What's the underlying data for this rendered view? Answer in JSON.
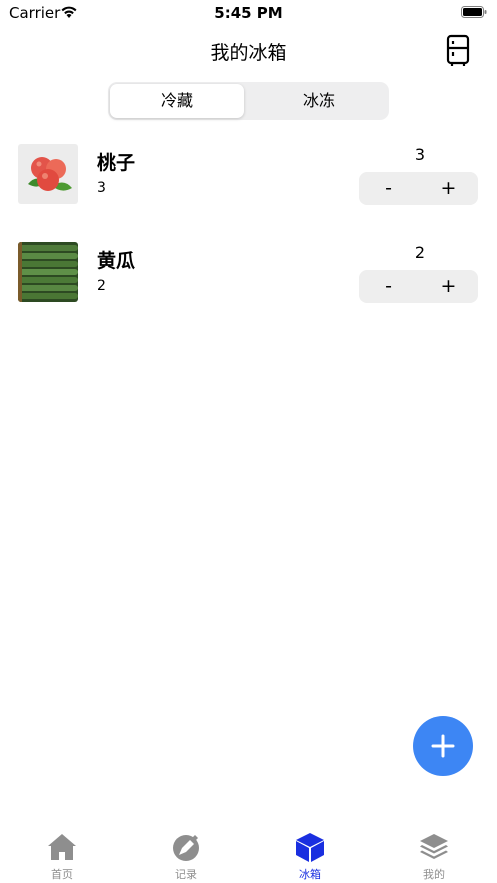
{
  "status_bar": {
    "carrier": "Carrier",
    "time": "5:45 PM"
  },
  "header": {
    "title": "我的冰箱",
    "fridge_icon": "fridge-icon"
  },
  "segments": {
    "active": "冷藏",
    "inactive": "冰冻"
  },
  "items": [
    {
      "name": "桃子",
      "quantity_text": "3",
      "count": "3",
      "minus": "-",
      "plus": "+",
      "image": "peach-photo"
    },
    {
      "name": "黄瓜",
      "quantity_text": "2",
      "count": "2",
      "minus": "-",
      "plus": "+",
      "image": "cucumber-photo"
    }
  ],
  "fab": {
    "icon": "plus-icon"
  },
  "tabs": [
    {
      "label": "首页",
      "icon": "home-icon"
    },
    {
      "label": "记录",
      "icon": "record-icon"
    },
    {
      "label": "冰箱",
      "icon": "box-icon"
    },
    {
      "label": "我的",
      "icon": "layers-icon"
    }
  ],
  "colors": {
    "accent": "#1a2fe0",
    "fab": "#3d86f4",
    "inactive_tab": "#8e8e8e",
    "segment_bg": "#eeeeef"
  }
}
